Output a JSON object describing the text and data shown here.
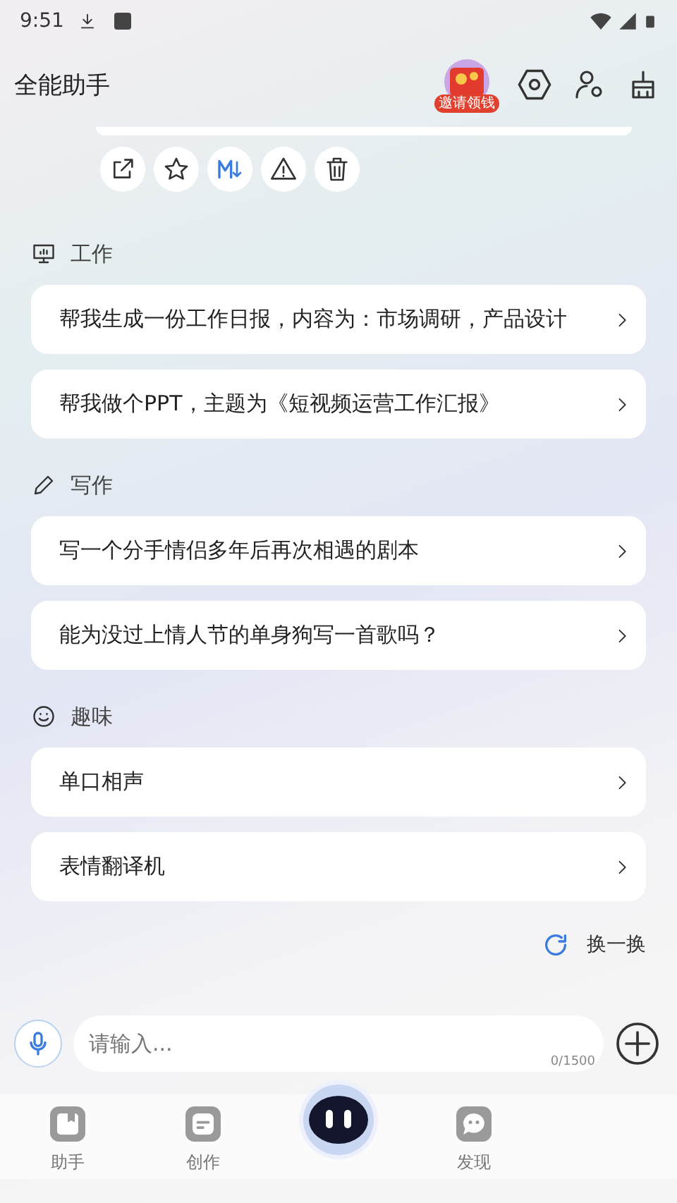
{
  "status_bar": {
    "time": "9:51"
  },
  "header": {
    "title": "全能助手",
    "badge": "邀请领钱"
  },
  "sections": [
    {
      "kind": "work",
      "title": "工作",
      "items": [
        "帮我生成一份工作日报，内容为：市场调研，产品设计",
        "帮我做个PPT，主题为《短视频运营工作汇报》"
      ]
    },
    {
      "kind": "writing",
      "title": "写作",
      "items": [
        "写一个分手情侣多年后再次相遇的剧本",
        "能为没过上情人节的单身狗写一首歌吗？"
      ]
    },
    {
      "kind": "fun",
      "title": "趣味",
      "items": [
        "单口相声",
        "表情翻译机"
      ]
    }
  ],
  "refresh": "换一换",
  "input": {
    "placeholder": "请输入...",
    "counter": "0/1500"
  },
  "tabs": [
    {
      "kind": "book",
      "label": "助手"
    },
    {
      "kind": "doc",
      "label": "创作"
    },
    {
      "kind": "robot"
    },
    {
      "kind": "chat",
      "label": "发现"
    }
  ]
}
